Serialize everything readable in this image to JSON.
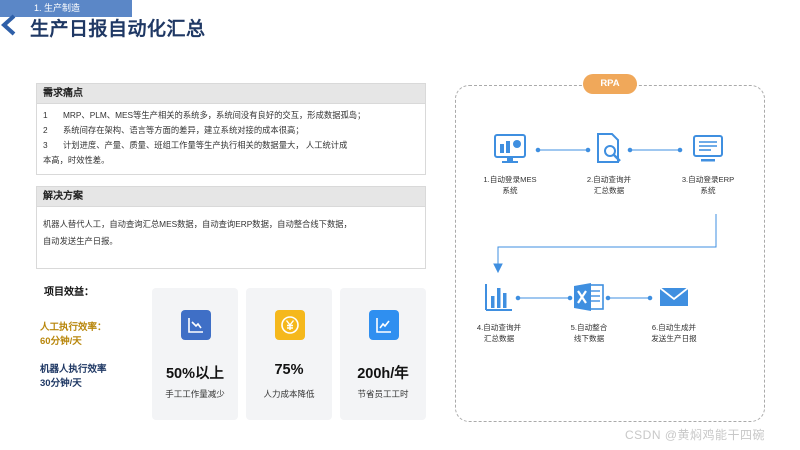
{
  "header": {
    "section_tag": "1. 生产制造",
    "title": "生产日报自动化汇总"
  },
  "pain_points": {
    "heading": "需求痛点",
    "items": [
      {
        "num": "1",
        "text": "MRP、PLM、MES等生产相关的系统多，系统间没有良好的交互，形成数据孤岛；"
      },
      {
        "num": "2",
        "text": "系统间存在架构、语言等方面的差异，建立系统对接的成本很高；"
      },
      {
        "num": "3",
        "text": "计划进度、产量、质量、班组工作量等生产执行相关的数据量大， 人工统计成"
      }
    ],
    "item3_cont": "本高，时效性差。"
  },
  "solution": {
    "heading": "解决方案",
    "line1": "机器人替代人工，自动查询汇总MES数据，自动查询ERP数据，自动整合线下数据，",
    "line2": "自动发送生产日报。"
  },
  "benefits": {
    "title": "项目效益：",
    "human_line1": "人工执行效率：",
    "human_line2": "60分钟/天",
    "robot_line1": "机器人执行效率",
    "robot_line2": "30分钟/天",
    "cards": [
      {
        "value": "50%以上",
        "label": "手工工作量减少",
        "icon": "chart-down-icon",
        "color": "#3f6fc6"
      },
      {
        "value": "75%",
        "label": "人力成本降低",
        "icon": "yen-coin-icon",
        "color": "#f5b81c"
      },
      {
        "value": "200h/年",
        "label": "节省员工工时",
        "icon": "chart-up-icon",
        "color": "#2f8ff0"
      }
    ]
  },
  "rpa": {
    "badge": "RPA",
    "accent": "#3f8fe0",
    "steps": [
      {
        "line1": "1.自动登录MES",
        "line2": "系统",
        "icon": "mes-dashboard-icon"
      },
      {
        "line1": "2.自动查询并",
        "line2": "汇总数据",
        "icon": "document-search-icon"
      },
      {
        "line1": "3.自动登录ERP",
        "line2": "系统",
        "icon": "monitor-icon"
      },
      {
        "line1": "4.自动查询并",
        "line2": "汇总数据",
        "icon": "bar-chart-icon"
      },
      {
        "line1": "5.自动整合",
        "line2": "线下数据",
        "icon": "excel-icon"
      },
      {
        "line1": "6.自动生成并",
        "line2": "发送生产日报",
        "icon": "mail-icon"
      }
    ]
  },
  "watermark": "CSDN @黄焖鸡能干四碗"
}
